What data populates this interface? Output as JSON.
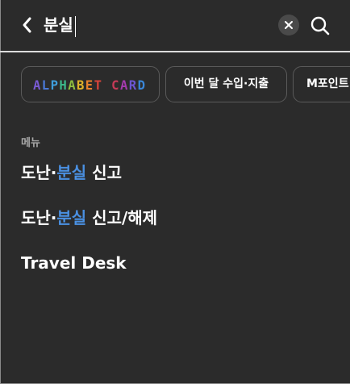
{
  "search": {
    "query": "분실",
    "back_icon": "chevron-left-icon",
    "clear_icon": "close-icon",
    "search_icon": "search-icon"
  },
  "chips": [
    {
      "label": "ALPHABET CARD",
      "letter_colors": [
        "#7a5bd6",
        "#4a79d8",
        "#3f9fdb",
        "#3cb88a",
        "#8fbf3f",
        "#e0b32a",
        "#e8812d",
        "#d8433a",
        "#c53b57",
        "#a63bb0",
        "#6b56d2",
        "#3a86d8"
      ]
    },
    {
      "label": "이번 달 수입·지출"
    },
    {
      "label": "M포인트"
    }
  ],
  "menu": {
    "section_label": "메뉴",
    "items": [
      {
        "pre": "도난·",
        "highlight": "분실",
        "post": " 신고"
      },
      {
        "pre": "도난·",
        "highlight": "분실",
        "post": " 신고/해제"
      },
      {
        "pre": "Travel Desk",
        "highlight": "",
        "post": ""
      }
    ]
  },
  "colors": {
    "background": "#2b2b2b",
    "highlight": "#4a90e2",
    "section_label": "#a8a8a8"
  }
}
